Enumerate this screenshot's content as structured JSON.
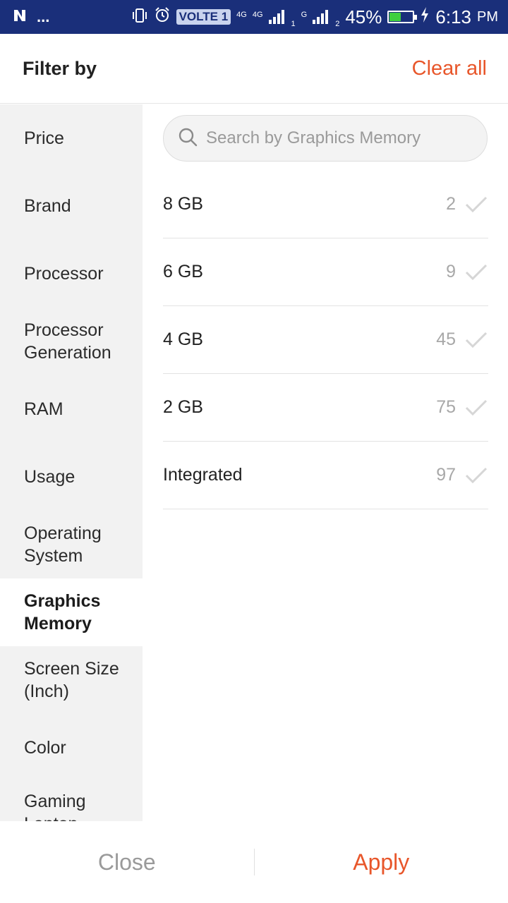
{
  "status_bar": {
    "time": "6:13",
    "ampm": "PM",
    "battery": "45%",
    "battery_level": 0.45,
    "volte": "VOLTE 1",
    "network_1": "4G",
    "network_2": "4G",
    "sim1": "1",
    "sim2": "2",
    "sim2_type": "G",
    "notification_dots": "..."
  },
  "header": {
    "title": "Filter by",
    "clear_all": "Clear all",
    "accent_color": "#e8562a"
  },
  "sidebar": {
    "items": [
      {
        "label": "Price"
      },
      {
        "label": "Brand"
      },
      {
        "label": "Processor"
      },
      {
        "label": "Processor Generation"
      },
      {
        "label": "RAM"
      },
      {
        "label": "Usage"
      },
      {
        "label": "Operating System"
      },
      {
        "label": "Graphics Memory"
      },
      {
        "label": "Screen Size (Inch)"
      },
      {
        "label": "Color"
      },
      {
        "label": "Gaming Laptop"
      }
    ],
    "active_index": 7
  },
  "main": {
    "search_placeholder": "Search by Graphics Memory",
    "options": [
      {
        "label": "8 GB",
        "count": "2"
      },
      {
        "label": "6 GB",
        "count": "9"
      },
      {
        "label": "4 GB",
        "count": "45"
      },
      {
        "label": "2 GB",
        "count": "75"
      },
      {
        "label": "Integrated",
        "count": "97"
      }
    ]
  },
  "footer": {
    "close_label": "Close",
    "apply_label": "Apply"
  }
}
